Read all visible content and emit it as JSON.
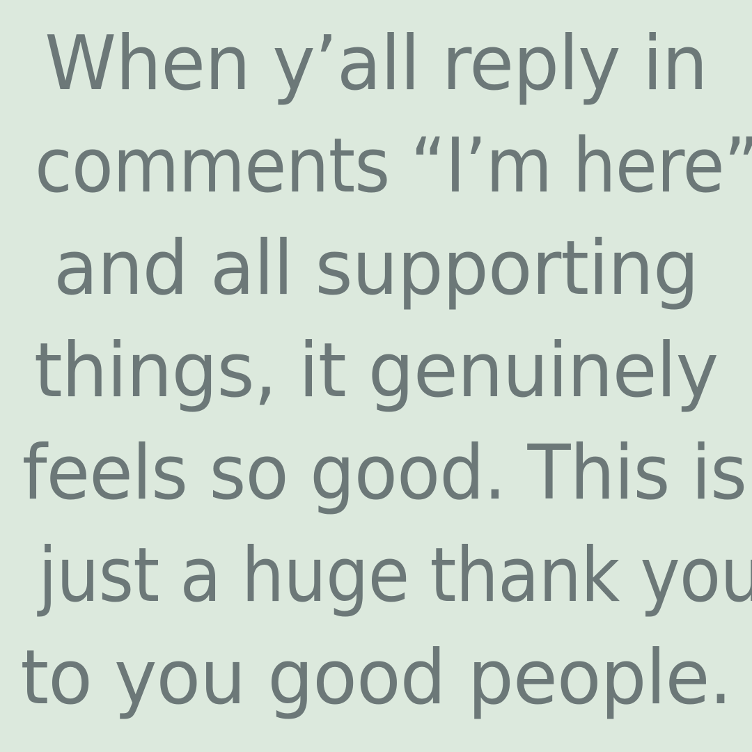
{
  "colors": {
    "background": "#DCE9DD",
    "text": "#6C7878"
  },
  "post": {
    "lines": [
      "When y’all reply in",
      "comments “I’m here”",
      "and all supporting",
      "things, it genuinely",
      "feels so good. This is",
      "just a huge thank you",
      "to you good people."
    ]
  }
}
